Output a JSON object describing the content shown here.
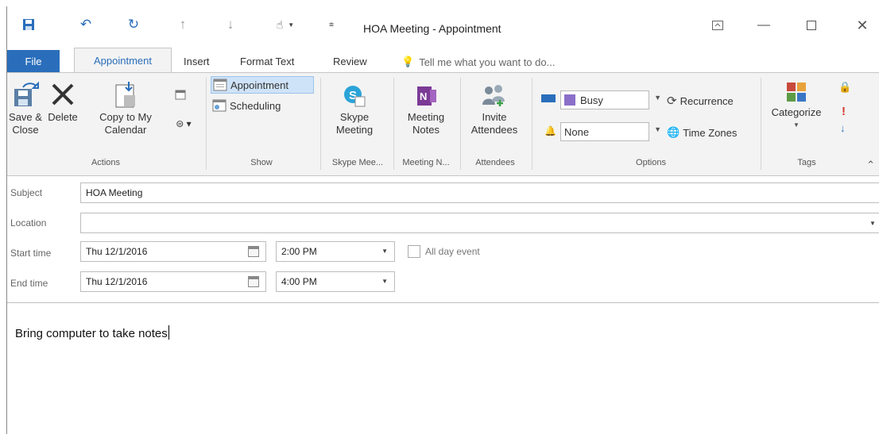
{
  "window": {
    "title": "HOA Meeting - Appointment",
    "controls": [
      "ribbon-display-options",
      "minimize",
      "maximize",
      "close"
    ]
  },
  "quick_access": [
    "save-icon",
    "undo-icon",
    "redo-icon",
    "previous-item-icon",
    "next-item-icon",
    "touch-mode-icon",
    "customize-icon"
  ],
  "tabs": {
    "file": "File",
    "active": "Appointment",
    "others": [
      "Insert",
      "Format Text",
      "Review"
    ],
    "tell_me": "Tell me what you want to do..."
  },
  "ribbon": {
    "actions": {
      "save_close_1": "Save &",
      "save_close_2": "Close",
      "delete": "Delete",
      "copy_1": "Copy to My",
      "copy_2": "Calendar",
      "label": "Actions"
    },
    "show": {
      "appointment": "Appointment",
      "scheduling": "Scheduling",
      "label": "Show"
    },
    "skype": {
      "line1": "Skype",
      "line2": "Meeting",
      "label": "Skype Mee..."
    },
    "meeting_notes": {
      "line1": "Meeting",
      "line2": "Notes",
      "label": "Meeting N..."
    },
    "attendees": {
      "line1": "Invite",
      "line2": "Attendees",
      "label": "Attendees"
    },
    "options": {
      "show_as": "Busy",
      "reminder": "None",
      "recurrence": "Recurrence",
      "time_zones": "Time Zones",
      "label": "Options",
      "busy_color": "#8b6fc9"
    },
    "tags": {
      "categorize": "Categorize",
      "label": "Tags"
    }
  },
  "form": {
    "subject_label": "Subject",
    "subject": "HOA Meeting",
    "location_label": "Location",
    "location": "",
    "start_label": "Start time",
    "start_date": "Thu 12/1/2016",
    "start_time": "2:00 PM",
    "all_day": "All day event",
    "end_label": "End time",
    "end_date": "Thu 12/1/2016",
    "end_time": "4:00 PM"
  },
  "body": {
    "text": "Bring computer to take notes"
  },
  "colors": {
    "accent": "#2a6ebb",
    "ribbon_bg": "#f3f3f3"
  }
}
